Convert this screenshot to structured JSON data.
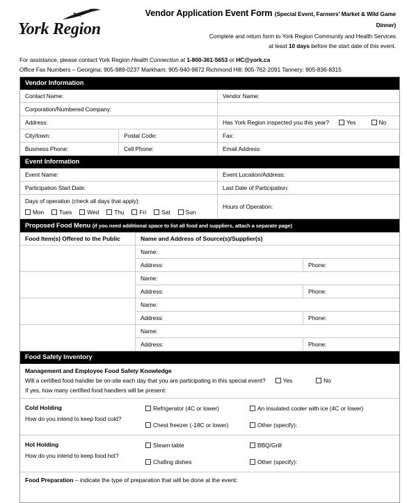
{
  "header": {
    "logo_text": "York Region",
    "logo_icon": "swoosh-bird-icon",
    "title_main": "Vendor Application Event Form",
    "title_paren": "(Special Event, Farmers' Market & Wild Game Dinner)",
    "subtitle_line1": "Complete and return form to York Region Community and Health Services",
    "subtitle_line2_pre": "at least ",
    "subtitle_line2_bold": "10 days",
    "subtitle_line2_post": " before the start date of this event."
  },
  "contact": {
    "line1_pre": "For assistance, please contact York Region ",
    "line1_italic": "Health Connection",
    "line1_mid": " at ",
    "line1_phone": "1-800-361-5653",
    "line1_or": " or ",
    "line1_email": "HC@york.ca",
    "line2": "Office Fax Numbers – Georgina: 905-989-0237 Markham: 905-940-9872 Richmond Hill: 905-762-2091 Tannery: 905-836-8315"
  },
  "vendor_information": {
    "section_title": "Vendor Information",
    "contact_name": "Contact Name:",
    "vendor_name": "Vendor Name:",
    "corporation": "Corporation/Numbered Company:",
    "corporation_right": "",
    "address": "Address:",
    "inspected_question": "Has York Region inspected you this year?",
    "inspected_yes": "Yes",
    "inspected_no": "No",
    "city_town": "City/town:",
    "postal_code": "Postal Code:",
    "fax": "Fax:",
    "business_phone": "Business Phone:",
    "cell_phone": "Cell Phone:",
    "email_address": "Email Address:"
  },
  "event_information": {
    "section_title": "Event Information",
    "event_name": "Event Name:",
    "event_location": "Event Location/Address:",
    "participation_start": "Participation Start Date:",
    "last_date": "Last Date of Participation:",
    "days_label": "Days of operation (check all days that apply):",
    "days": [
      "Mon",
      "Tues",
      "Wed",
      "Thu",
      "Fri",
      "Sat",
      "Sun"
    ],
    "hours_of_operation": "Hours of Operation:"
  },
  "food_menu": {
    "section_title": "Proposed Food Menu",
    "section_note": "(if you need additional space to list all food and suppliers, attach a separate page)",
    "col_food_item": "Food Item(s) Offered to the Public",
    "col_supplier": "Name and Address of Source(s)/Supplier(s)",
    "rows": [
      {
        "food_item": "",
        "name": "Name:",
        "address": "Address:",
        "phone": "Phone:"
      },
      {
        "food_item": "",
        "name": "Name:",
        "address": "Address:",
        "phone": "Phone:"
      },
      {
        "food_item": "",
        "name": "Name:",
        "address": "Address:",
        "phone": "Phone:"
      },
      {
        "food_item": "",
        "name": "Name:",
        "address": "Address:",
        "phone": "Phone:"
      }
    ]
  },
  "food_safety": {
    "section_title": "Food Safety Inventory",
    "knowledge_heading": "Management and Employee Food Safety Knowledge",
    "handler_question": "Will a certified food handler be on-site each day that you are participating in this special event?",
    "handler_yes": "Yes",
    "handler_no": "No",
    "handler_followup": "If yes, how many certified food handlers will be present:",
    "cold_holding": {
      "title": "Cold Holding",
      "sub": "How do you intend to keep food cold?",
      "opt1": "Refrigerator (4C or lower)",
      "opt2": "An insulated cooler with ice (4C or lower)",
      "opt3": "Chest freezer (-18C or lower)",
      "opt4": "Other (specify):"
    },
    "hot_holding": {
      "title": "Hot Holding",
      "sub": "How do you intend to keep food hot?",
      "opt1": "Steam table",
      "opt2": "BBQ/Grill",
      "opt3": "Chafing dishes",
      "opt4": "Other (specify):"
    },
    "food_preparation_bold": "Food Preparation",
    "food_preparation_rest": " – indicate the type of preparation that will be done at the event:"
  },
  "colors": {
    "bar_background": "#000000",
    "bar_text": "#ffffff",
    "border": "#c8c8c8",
    "outer_border": "#9a9a9a"
  }
}
